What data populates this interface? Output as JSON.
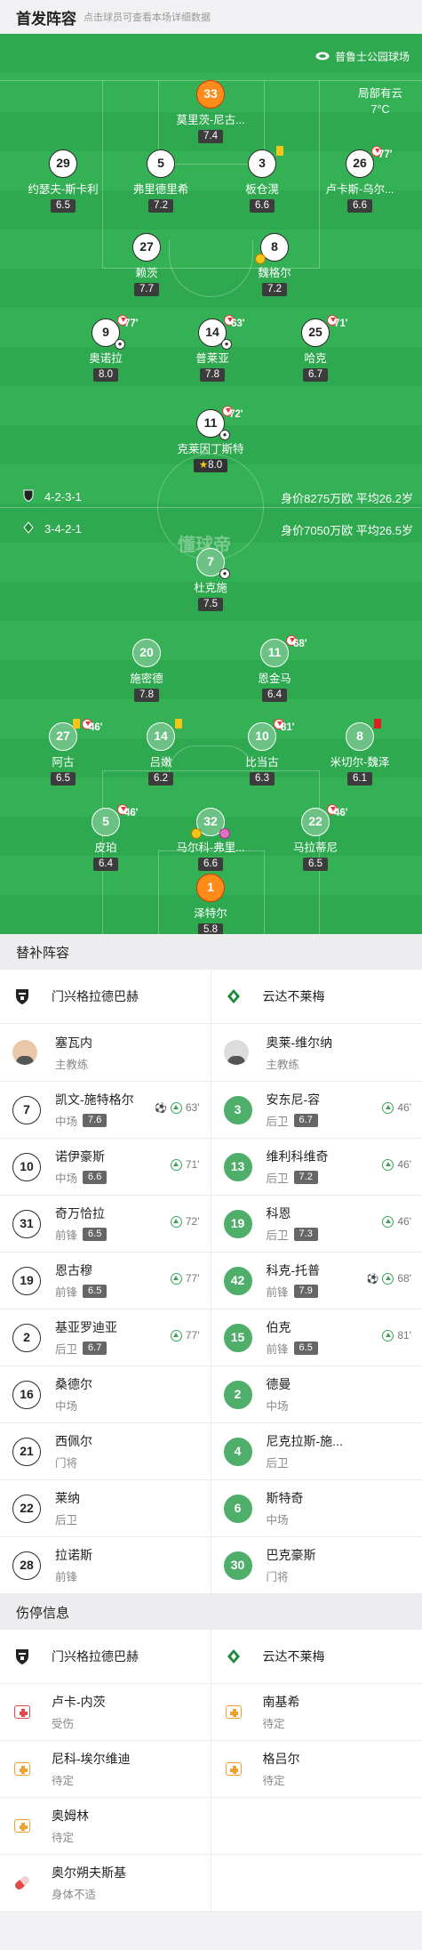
{
  "header": {
    "title": "首发阵容",
    "subtitle": "点击球员可查看本场详细数据"
  },
  "pitch": {
    "stadium": "普鲁士公园球场",
    "weather_line1": "局部有云",
    "weather_line2": "7°C",
    "watermark": "懂球帝",
    "home_formation": "4-2-3-1",
    "home_value": "身价8275万欧 平均26.2岁",
    "away_formation": "3-4-2-1",
    "away_value": "身价7050万欧 平均26.5岁"
  },
  "players": {
    "h1": {
      "num": "33",
      "name": "莫里茨-尼古...",
      "rating": "7.4"
    },
    "h2": {
      "num": "29",
      "name": "约瑟夫-斯卡利",
      "rating": "6.5"
    },
    "h3": {
      "num": "5",
      "name": "弗里德里希",
      "rating": "7.2"
    },
    "h4": {
      "num": "3",
      "name": "板仓滉",
      "rating": "6.6"
    },
    "h5": {
      "num": "26",
      "name": "卢卡斯-乌尔...",
      "rating": "6.6",
      "sub": "77'"
    },
    "h6": {
      "num": "27",
      "name": "赖茨",
      "rating": "7.7"
    },
    "h7": {
      "num": "8",
      "name": "魏格尔",
      "rating": "7.2"
    },
    "h8": {
      "num": "9",
      "name": "奥诺拉",
      "rating": "8.0",
      "sub": "77'"
    },
    "h9": {
      "num": "14",
      "name": "普莱亚",
      "rating": "7.8",
      "sub": "63'"
    },
    "h10": {
      "num": "25",
      "name": "哈克",
      "rating": "6.7",
      "sub": "71'"
    },
    "h11": {
      "num": "11",
      "name": "克莱因丁斯特",
      "rating": "8.0",
      "sub": "72'"
    },
    "a1": {
      "num": "7",
      "name": "杜克施",
      "rating": "7.5"
    },
    "a2": {
      "num": "20",
      "name": "施密德",
      "rating": "7.8"
    },
    "a3": {
      "num": "11",
      "name": "恩金马",
      "rating": "6.4",
      "sub": "68'"
    },
    "a4": {
      "num": "27",
      "name": "阿古",
      "rating": "6.5",
      "sub": "46'"
    },
    "a5": {
      "num": "14",
      "name": "吕嫩",
      "rating": "6.2"
    },
    "a6": {
      "num": "10",
      "name": "比当古",
      "rating": "6.3",
      "sub": "81'"
    },
    "a7": {
      "num": "8",
      "name": "米切尔-魏泽",
      "rating": "6.1"
    },
    "a8": {
      "num": "5",
      "name": "皮珀",
      "rating": "6.4",
      "sub": "46'"
    },
    "a9": {
      "num": "32",
      "name": "马尔科-弗里...",
      "rating": "6.6"
    },
    "a10": {
      "num": "22",
      "name": "马拉蒂尼",
      "rating": "6.5",
      "sub": "46'"
    },
    "a11": {
      "num": "1",
      "name": "泽特尔",
      "rating": "5.8"
    }
  },
  "subs_section": {
    "title": "替补阵容",
    "home_team": "门兴格拉德巴赫",
    "away_team": "云达不莱梅",
    "home_coach": {
      "name": "塞瓦内",
      "role": "主教练"
    },
    "away_coach": {
      "name": "奥莱-维尔纳",
      "role": "主教练"
    },
    "home": [
      {
        "num": "7",
        "name": "凯文-施特格尔",
        "pos": "中场",
        "rating": "7.6",
        "time": "63'"
      },
      {
        "num": "10",
        "name": "诺伊豪斯",
        "pos": "中场",
        "rating": "6.6",
        "time": "71'"
      },
      {
        "num": "31",
        "name": "奇万恰拉",
        "pos": "前锋",
        "rating": "6.5",
        "time": "72'"
      },
      {
        "num": "19",
        "name": "恩古穆",
        "pos": "前锋",
        "rating": "6.5",
        "time": "77'"
      },
      {
        "num": "2",
        "name": "基亚罗迪亚",
        "pos": "后卫",
        "rating": "6.7",
        "time": "77'"
      },
      {
        "num": "16",
        "name": "桑德尔",
        "pos": "中场"
      },
      {
        "num": "21",
        "name": "西佩尔",
        "pos": "门将"
      },
      {
        "num": "22",
        "name": "莱纳",
        "pos": "后卫"
      },
      {
        "num": "28",
        "name": "拉诺斯",
        "pos": "前锋"
      }
    ],
    "away": [
      {
        "num": "3",
        "name": "安东尼-容",
        "pos": "后卫",
        "rating": "6.7",
        "time": "46'"
      },
      {
        "num": "13",
        "name": "维利科维奇",
        "pos": "后卫",
        "rating": "7.2",
        "time": "46'"
      },
      {
        "num": "19",
        "name": "科恩",
        "pos": "后卫",
        "rating": "7.3",
        "time": "46'"
      },
      {
        "num": "42",
        "name": "科克-托普",
        "pos": "前锋",
        "rating": "7.9",
        "time": "68'"
      },
      {
        "num": "15",
        "name": "伯克",
        "pos": "前锋",
        "rating": "6.5",
        "time": "81'"
      },
      {
        "num": "2",
        "name": "德曼",
        "pos": "中场"
      },
      {
        "num": "4",
        "name": "尼克拉斯-施...",
        "pos": "后卫"
      },
      {
        "num": "6",
        "name": "斯特奇",
        "pos": "中场"
      },
      {
        "num": "30",
        "name": "巴克豪斯",
        "pos": "门将"
      }
    ]
  },
  "injury_section": {
    "title": "伤停信息",
    "home_team": "门兴格拉德巴赫",
    "away_team": "云达不莱梅",
    "home": [
      {
        "name": "卢卡-内茨",
        "status": "受伤"
      },
      {
        "name": "尼科-埃尔维迪",
        "status": "待定"
      },
      {
        "name": "奥姆林",
        "status": "待定"
      },
      {
        "name": "奥尔朔夫斯基",
        "status": "身体不适"
      }
    ],
    "away": [
      {
        "name": "南基希",
        "status": "待定"
      },
      {
        "name": "格吕尔",
        "status": "待定"
      }
    ]
  },
  "colors": {
    "pitch": "#2fa94f",
    "away_circle": "#4fae6a",
    "gk": "#ff8c1a",
    "yellow_card": "#f5c518",
    "red_card": "#e02020"
  }
}
